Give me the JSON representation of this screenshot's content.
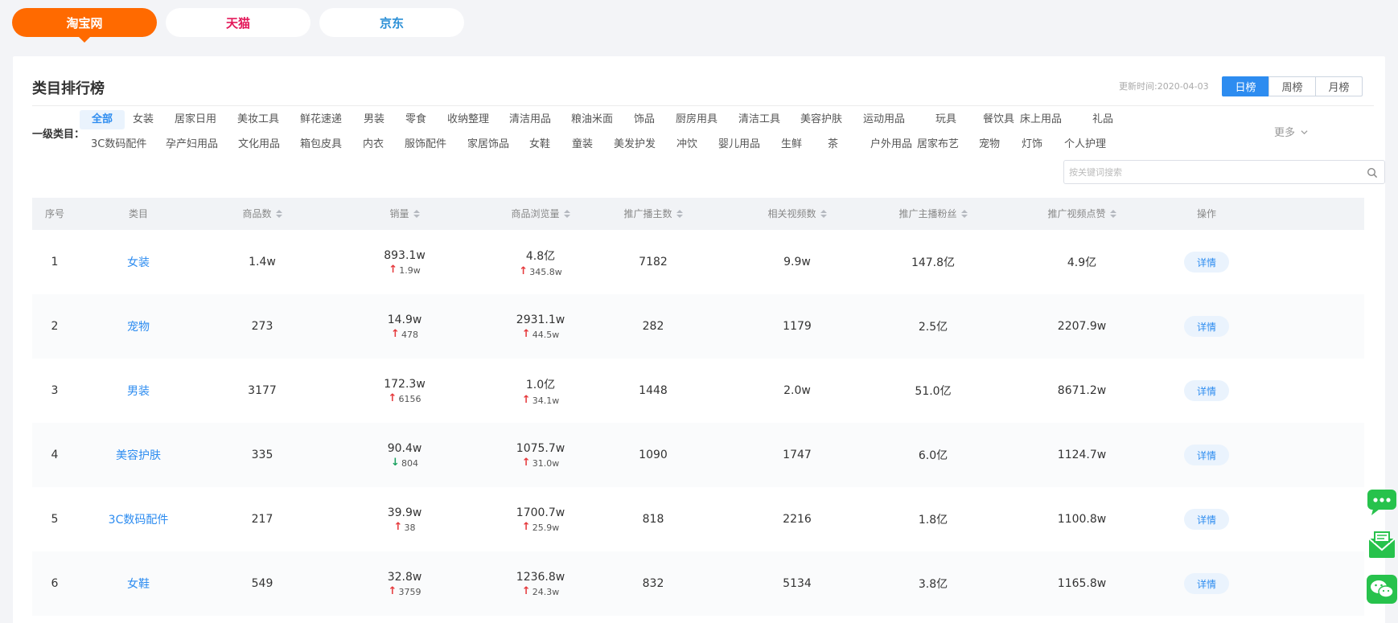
{
  "platform_tabs": [
    {
      "label": "淘宝网",
      "active": true
    },
    {
      "label": "天猫",
      "active": false
    },
    {
      "label": "京东",
      "active": false
    }
  ],
  "card": {
    "title": "类目排行榜",
    "update_time": "更新时间:2020-04-03",
    "periods": [
      "日榜",
      "周榜",
      "月榜"
    ],
    "active_period": "日榜"
  },
  "categories": {
    "label": "一级类目：",
    "row1": [
      "全部",
      "女装",
      "居家日用",
      "美妆工具",
      "鲜花速递",
      "男装",
      "零食",
      "收纳整理",
      "清洁用品",
      "粮油米面",
      "饰品",
      "厨房用具",
      "清洁工具",
      "美容护肤",
      "运动用品",
      "玩具",
      "餐饮具",
      "床上用品",
      "礼品"
    ],
    "row2": [
      "3C数码配件",
      "孕产妇用品",
      "文化用品",
      "箱包皮具",
      "内衣",
      "服饰配件",
      "家居饰品",
      "女鞋",
      "童装",
      "美发护发",
      "冲饮",
      "婴儿用品",
      "生鲜",
      "茶",
      "户外用品",
      "居家布艺",
      "宠物",
      "灯饰",
      "个人护理"
    ],
    "active": "全部",
    "more": "更多"
  },
  "search": {
    "placeholder": "按关键词搜索",
    "value": ""
  },
  "table": {
    "headers": [
      "序号",
      "类目",
      "商品数",
      "销量",
      "商品浏览量",
      "推广播主数",
      "相关视频数",
      "推广主播粉丝",
      "推广视频点赞",
      "操作"
    ],
    "rows": [
      {
        "rank": "1",
        "category": "女装",
        "products": "1.4w",
        "sales": "893.1w",
        "sales_delta": "1.9w",
        "sales_dir": "up",
        "views": "4.8亿",
        "views_delta": "345.8w",
        "views_dir": "up",
        "promoters": "7182",
        "videos": "9.9w",
        "fans": "147.8亿",
        "likes": "4.9亿",
        "action": "详情"
      },
      {
        "rank": "2",
        "category": "宠物",
        "products": "273",
        "sales": "14.9w",
        "sales_delta": "478",
        "sales_dir": "up",
        "views": "2931.1w",
        "views_delta": "44.5w",
        "views_dir": "up",
        "promoters": "282",
        "videos": "1179",
        "fans": "2.5亿",
        "likes": "2207.9w",
        "action": "详情"
      },
      {
        "rank": "3",
        "category": "男装",
        "products": "3177",
        "sales": "172.3w",
        "sales_delta": "6156",
        "sales_dir": "up",
        "views": "1.0亿",
        "views_delta": "34.1w",
        "views_dir": "up",
        "promoters": "1448",
        "videos": "2.0w",
        "fans": "51.0亿",
        "likes": "8671.2w",
        "action": "详情"
      },
      {
        "rank": "4",
        "category": "美容护肤",
        "products": "335",
        "sales": "90.4w",
        "sales_delta": "804",
        "sales_dir": "down",
        "views": "1075.7w",
        "views_delta": "31.0w",
        "views_dir": "up",
        "promoters": "1090",
        "videos": "1747",
        "fans": "6.0亿",
        "likes": "1124.7w",
        "action": "详情"
      },
      {
        "rank": "5",
        "category": "3C数码配件",
        "products": "217",
        "sales": "39.9w",
        "sales_delta": "38",
        "sales_dir": "up",
        "views": "1700.7w",
        "views_delta": "25.9w",
        "views_dir": "up",
        "promoters": "818",
        "videos": "2216",
        "fans": "1.8亿",
        "likes": "1100.8w",
        "action": "详情"
      },
      {
        "rank": "6",
        "category": "女鞋",
        "products": "549",
        "sales": "32.8w",
        "sales_delta": "3759",
        "sales_dir": "up",
        "views": "1236.8w",
        "views_delta": "24.3w",
        "views_dir": "up",
        "promoters": "832",
        "videos": "5134",
        "fans": "3.8亿",
        "likes": "1165.8w",
        "action": "详情"
      }
    ]
  },
  "side_icons": [
    "chat-icon",
    "mail-icon",
    "wechat-icon"
  ],
  "colors": {
    "accent": "#2d8cf0",
    "taobao": "#ff6a00",
    "tmall": "#e3195a",
    "up": "#e5383b",
    "down": "#19a15f"
  }
}
